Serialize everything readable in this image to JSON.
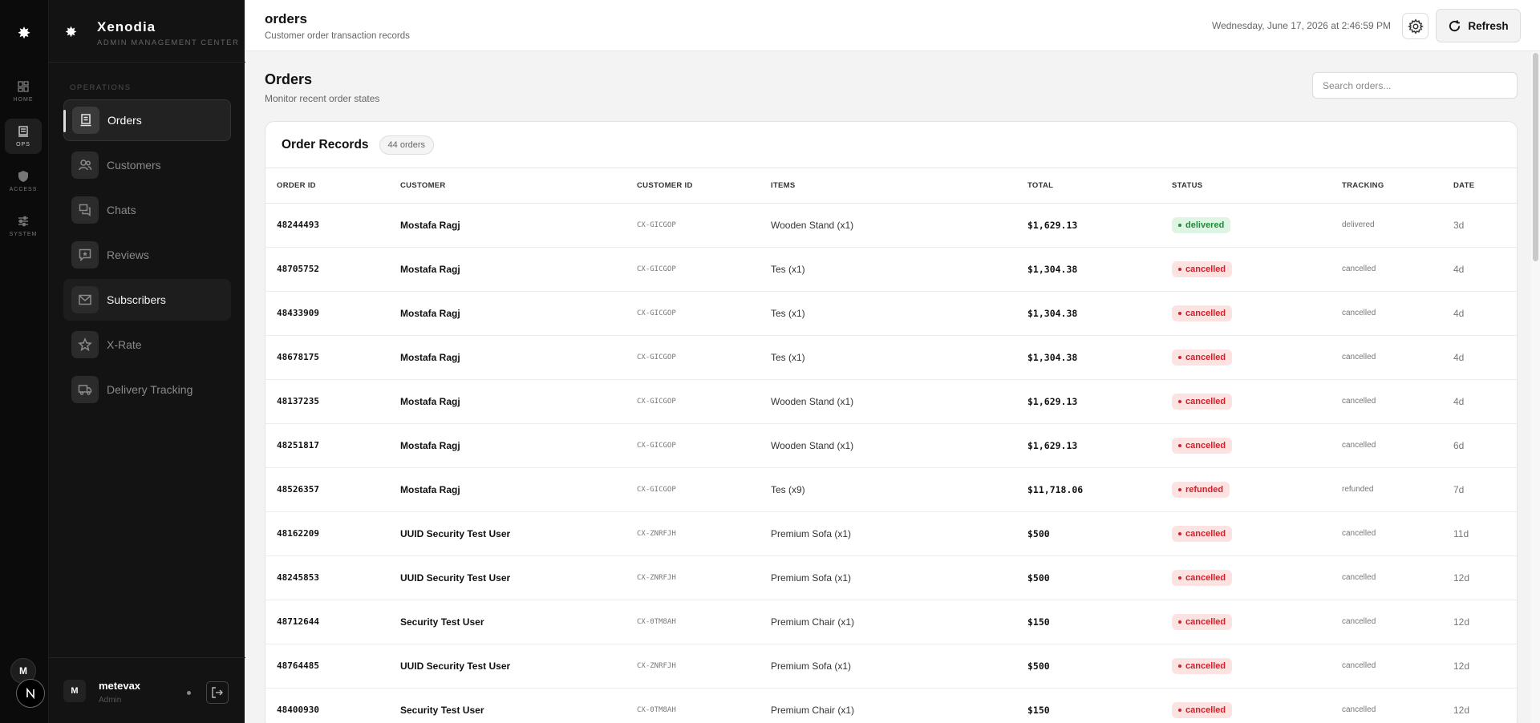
{
  "rail": {
    "logo": "✸",
    "items": [
      {
        "label": "HOME",
        "icon": "grid-icon"
      },
      {
        "label": "OPS",
        "icon": "document-icon"
      },
      {
        "label": "ACCESS",
        "icon": "shield-icon"
      },
      {
        "label": "SYSTEM",
        "icon": "sliders-icon"
      }
    ],
    "avatar_letter": "M",
    "n_logo": "N"
  },
  "sidebar": {
    "brand": {
      "icon": "✸",
      "name": "Xenodia",
      "subtitle": "ADMIN MANAGEMENT CENTER"
    },
    "section_label": "OPERATIONS",
    "items": [
      {
        "label": "Orders",
        "icon": "receipt-icon"
      },
      {
        "label": "Customers",
        "icon": "users-icon"
      },
      {
        "label": "Chats",
        "icon": "chat-icon"
      },
      {
        "label": "Reviews",
        "icon": "star-message-icon"
      },
      {
        "label": "Subscribers",
        "icon": "mail-icon"
      },
      {
        "label": "X-Rate",
        "icon": "star-icon"
      },
      {
        "label": "Delivery Tracking",
        "icon": "truck-icon"
      }
    ],
    "user": {
      "initial": "M",
      "name": "metevax",
      "role": "Admin"
    }
  },
  "topbar": {
    "title": "orders",
    "subtitle": "Customer order transaction records",
    "datetime": "Wednesday, June 17, 2026 at 2:46:59 PM",
    "refresh_label": "Refresh"
  },
  "page": {
    "title": "Orders",
    "subtitle": "Monitor recent order states",
    "search_placeholder": "Search orders..."
  },
  "card": {
    "title": "Order Records",
    "count": "44 orders",
    "columns": [
      "ORDER ID",
      "CUSTOMER",
      "CUSTOMER ID",
      "ITEMS",
      "TOTAL",
      "STATUS",
      "TRACKING",
      "DATE"
    ],
    "rows": [
      {
        "id": "48244493",
        "customer": "Mostafa Ragj",
        "cid": "CX-GICGOP",
        "items": "Wooden Stand (x1)",
        "total": "$1,629.13",
        "status": "delivered",
        "tracking": "delivered",
        "date": "3d"
      },
      {
        "id": "48705752",
        "customer": "Mostafa Ragj",
        "cid": "CX-GICGOP",
        "items": "Tes (x1)",
        "total": "$1,304.38",
        "status": "cancelled",
        "tracking": "cancelled",
        "date": "4d"
      },
      {
        "id": "48433909",
        "customer": "Mostafa Ragj",
        "cid": "CX-GICGOP",
        "items": "Tes (x1)",
        "total": "$1,304.38",
        "status": "cancelled",
        "tracking": "cancelled",
        "date": "4d"
      },
      {
        "id": "48678175",
        "customer": "Mostafa Ragj",
        "cid": "CX-GICGOP",
        "items": "Tes (x1)",
        "total": "$1,304.38",
        "status": "cancelled",
        "tracking": "cancelled",
        "date": "4d"
      },
      {
        "id": "48137235",
        "customer": "Mostafa Ragj",
        "cid": "CX-GICGOP",
        "items": "Wooden Stand (x1)",
        "total": "$1,629.13",
        "status": "cancelled",
        "tracking": "cancelled",
        "date": "4d"
      },
      {
        "id": "48251817",
        "customer": "Mostafa Ragj",
        "cid": "CX-GICGOP",
        "items": "Wooden Stand (x1)",
        "total": "$1,629.13",
        "status": "cancelled",
        "tracking": "cancelled",
        "date": "6d"
      },
      {
        "id": "48526357",
        "customer": "Mostafa Ragj",
        "cid": "CX-GICGOP",
        "items": "Tes (x9)",
        "total": "$11,718.06",
        "status": "refunded",
        "tracking": "refunded",
        "date": "7d"
      },
      {
        "id": "48162209",
        "customer": "UUID Security Test User",
        "cid": "CX-ZNRFJH",
        "items": "Premium Sofa (x1)",
        "total": "$500",
        "status": "cancelled",
        "tracking": "cancelled",
        "date": "11d"
      },
      {
        "id": "48245853",
        "customer": "UUID Security Test User",
        "cid": "CX-ZNRFJH",
        "items": "Premium Sofa (x1)",
        "total": "$500",
        "status": "cancelled",
        "tracking": "cancelled",
        "date": "12d"
      },
      {
        "id": "48712644",
        "customer": "Security Test User",
        "cid": "CX-0TM8AH",
        "items": "Premium Chair (x1)",
        "total": "$150",
        "status": "cancelled",
        "tracking": "cancelled",
        "date": "12d"
      },
      {
        "id": "48764485",
        "customer": "UUID Security Test User",
        "cid": "CX-ZNRFJH",
        "items": "Premium Sofa (x1)",
        "total": "$500",
        "status": "cancelled",
        "tracking": "cancelled",
        "date": "12d"
      },
      {
        "id": "48400930",
        "customer": "Security Test User",
        "cid": "CX-0TM8AH",
        "items": "Premium Chair (x1)",
        "total": "$150",
        "status": "cancelled",
        "tracking": "cancelled",
        "date": "12d"
      }
    ]
  },
  "colors": {
    "delivered_bg": "#dff5e3",
    "delivered_fg": "#1e8a3a",
    "cancelled_bg": "#fde2e2",
    "cancelled_fg": "#d0202a",
    "refunded_bg": "#fde2e2",
    "refunded_fg": "#d0202a"
  }
}
